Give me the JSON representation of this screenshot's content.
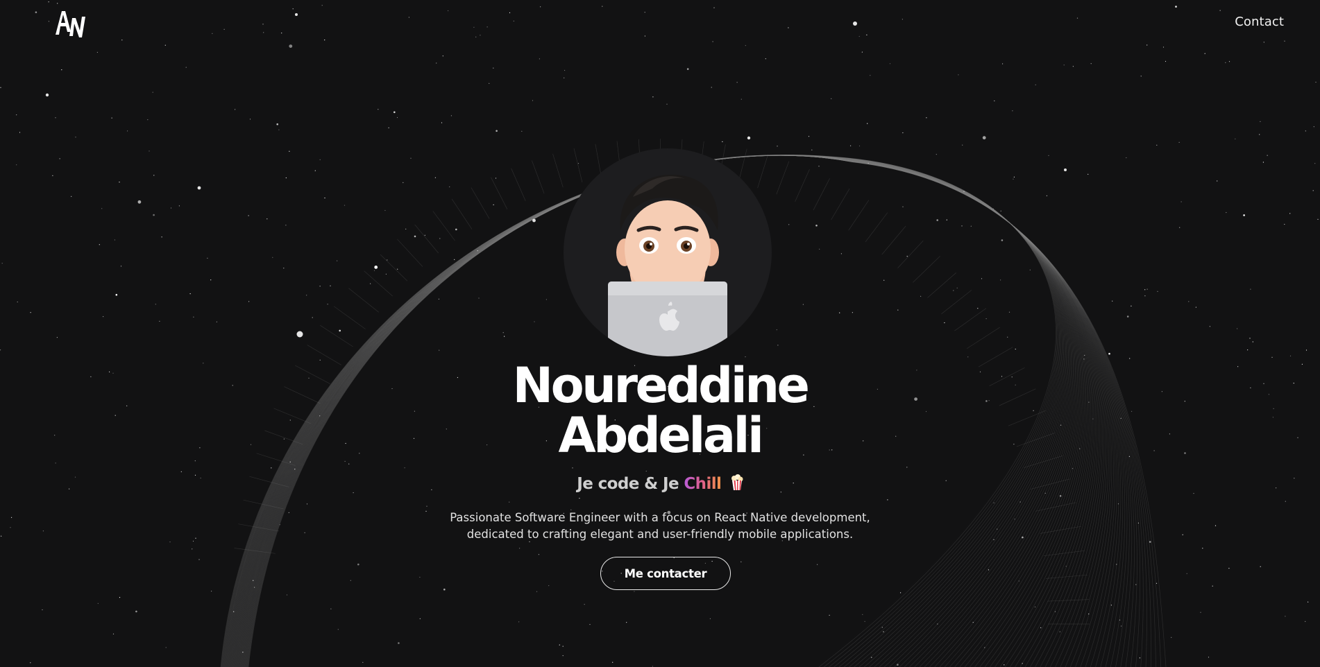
{
  "header": {
    "logo_alt": "AN",
    "nav_contact_label": "Contact"
  },
  "hero": {
    "name_first": "Noureddine",
    "name_last": "Abdelali",
    "tagline_prefix": "Je code & Je ",
    "tagline_highlight": "Chill",
    "tagline_emoji": "popcorn-icon",
    "bio_line1": "Passionate Software Engineer with a focus on React Native development,",
    "bio_line2": "dedicated to crafting elegant and user-friendly mobile applications.",
    "cta_label": "Me contacter",
    "avatar_icon": "memoji-avatar-with-laptop-icon"
  },
  "colors": {
    "background": "#121213",
    "text": "#ffffff",
    "gradient_start": "#b65bd9",
    "gradient_mid": "#e0608a",
    "gradient_end": "#f39447"
  }
}
